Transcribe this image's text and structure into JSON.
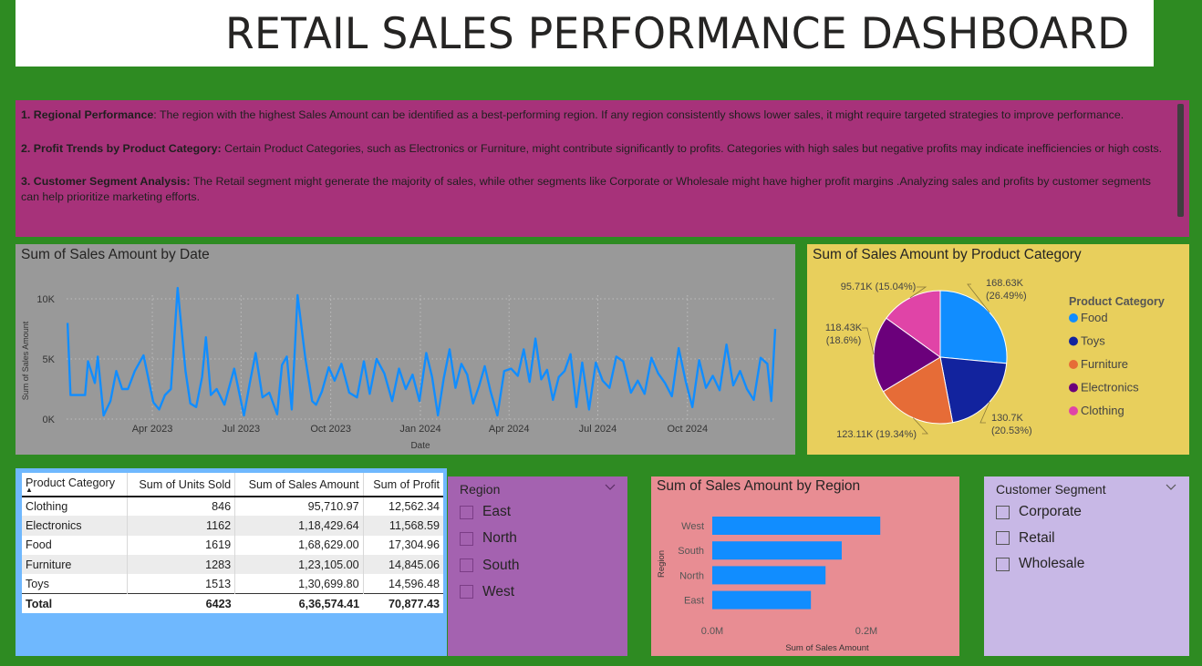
{
  "title": "RETAIL SALES PERFORMANCE DASHBOARD",
  "insights": [
    {
      "heading": "1. Regional Performance",
      "sep": ":   ",
      "text": "The region with the highest Sales Amount can be identified as a best-performing region. If any region consistently shows lower sales, it might require targeted strategies to improve performance."
    },
    {
      "heading": "2. Profit Trends by Product Category:",
      "sep": " ",
      "text": "Certain Product Categories, such as Electronics or Furniture, might contribute significantly to profits. Categories with high sales but negative profits may indicate inefficiencies or high costs."
    },
    {
      "heading": "3. Customer Segment Analysis:",
      "sep": " ",
      "text": "The Retail segment might generate the majority of sales, while other segments like Corporate or Wholesale might have higher profit margins .Analyzing sales and profits by customer segments can help prioritize marketing efforts."
    }
  ],
  "colors": {
    "background": "#2e8b22",
    "insights": "#a7327a",
    "line": "#118dff",
    "date_panel": "#999999",
    "category_panel": "#e8cf5c",
    "table_panel": "#6fb8fe",
    "region_slicer": "#a462b0",
    "region_bar_panel": "#e88d93",
    "segment_slicer": "#c8b8e6",
    "bar": "#118dff"
  },
  "table": {
    "headers": [
      "Product Category",
      "Sum of Units Sold",
      "Sum of Sales Amount",
      "Sum of Profit"
    ],
    "sort_icon": "sort-ascending-icon",
    "rows": [
      [
        "Clothing",
        "846",
        "95,710.97",
        "12,562.34"
      ],
      [
        "Electronics",
        "1162",
        "1,18,429.64",
        "11,568.59"
      ],
      [
        "Food",
        "1619",
        "1,68,629.00",
        "17,304.96"
      ],
      [
        "Furniture",
        "1283",
        "1,23,105.00",
        "14,845.06"
      ],
      [
        "Toys",
        "1513",
        "1,30,699.80",
        "14,596.48"
      ]
    ],
    "total": [
      "Total",
      "6423",
      "6,36,574.41",
      "70,877.43"
    ]
  },
  "region_slicer": {
    "title": "Region",
    "options": [
      "East",
      "North",
      "South",
      "West"
    ],
    "icon": "chevron-down-icon"
  },
  "segment_slicer": {
    "title": "Customer Segment",
    "options": [
      "Corporate",
      "Retail",
      "Wholesale"
    ],
    "icon": "chevron-down-icon"
  },
  "chart_data": [
    {
      "type": "line",
      "title": "Sum of Sales Amount by Date",
      "xlabel": "Date",
      "ylabel": "Sum of Sales Amount",
      "x_ticks": [
        "Apr 2023",
        "Jul 2023",
        "Oct 2023",
        "Jan 2024",
        "Apr 2024",
        "Jul 2024",
        "Oct 2024"
      ],
      "y_ticks": [
        "0K",
        "5K",
        "10K"
      ],
      "ylim": [
        0,
        10000
      ],
      "grid": true,
      "x_range": [
        "2023-01-03",
        "2024-12-30"
      ],
      "series": [
        {
          "x": [
            "2023-01-04",
            "2023-01-07",
            "2023-01-13",
            "2023-01-22",
            "2023-01-25",
            "2023-02-01",
            "2023-02-04",
            "2023-02-10",
            "2023-02-17",
            "2023-02-23",
            "2023-03-01",
            "2023-03-07",
            "2023-03-14",
            "2023-03-23",
            "2023-04-02",
            "2023-04-08",
            "2023-04-14",
            "2023-04-20",
            "2023-04-27",
            "2023-05-05",
            "2023-05-10",
            "2023-05-16",
            "2023-05-22",
            "2023-05-26",
            "2023-05-31",
            "2023-06-06",
            "2023-06-14",
            "2023-06-24",
            "2023-07-04",
            "2023-07-10",
            "2023-07-16",
            "2023-07-23",
            "2023-07-30",
            "2023-08-07",
            "2023-08-12",
            "2023-08-17",
            "2023-08-22",
            "2023-08-28",
            "2023-09-05",
            "2023-09-12",
            "2023-09-16",
            "2023-09-22",
            "2023-09-29",
            "2023-10-05",
            "2023-10-12",
            "2023-10-20",
            "2023-10-28",
            "2023-11-04",
            "2023-11-10",
            "2023-11-17",
            "2023-11-25",
            "2023-12-03",
            "2023-12-10",
            "2023-12-17",
            "2023-12-24",
            "2023-12-31",
            "2024-01-07",
            "2024-01-13",
            "2024-01-19",
            "2024-01-25",
            "2024-01-31",
            "2024-02-06",
            "2024-02-12",
            "2024-02-18",
            "2024-02-24",
            "2024-03-01",
            "2024-03-07",
            "2024-03-13",
            "2024-03-20",
            "2024-03-27",
            "2024-04-03",
            "2024-04-10",
            "2024-04-16",
            "2024-04-22",
            "2024-04-28",
            "2024-05-04",
            "2024-05-10",
            "2024-05-16",
            "2024-05-22",
            "2024-05-28",
            "2024-06-03",
            "2024-06-09",
            "2024-06-15",
            "2024-06-22",
            "2024-06-29",
            "2024-07-06",
            "2024-07-13",
            "2024-07-20",
            "2024-07-27",
            "2024-08-04",
            "2024-08-11",
            "2024-08-18",
            "2024-08-25",
            "2024-09-01",
            "2024-09-08",
            "2024-09-15",
            "2024-09-22",
            "2024-09-29",
            "2024-10-06",
            "2024-10-13",
            "2024-10-20",
            "2024-10-27",
            "2024-11-03",
            "2024-11-10",
            "2024-11-17",
            "2024-11-24",
            "2024-12-01",
            "2024-12-08",
            "2024-12-15",
            "2024-12-22",
            "2024-12-26",
            "2024-12-30"
          ],
          "values": [
            8000,
            2000,
            2000,
            2000,
            4800,
            3000,
            5200,
            300,
            1500,
            4000,
            2500,
            2500,
            4000,
            5300,
            1400,
            800,
            2000,
            2500,
            10900,
            4000,
            1300,
            1000,
            3500,
            6800,
            2000,
            2500,
            1200,
            4200,
            300,
            3000,
            5500,
            1800,
            2200,
            400,
            4500,
            5200,
            800,
            10300,
            5000,
            1500,
            1200,
            2300,
            4300,
            3200,
            4600,
            2200,
            1800,
            4800,
            2100,
            5000,
            3800,
            1500,
            4200,
            2500,
            3700,
            1500,
            5500,
            3500,
            300,
            3400,
            5800,
            2600,
            4600,
            3700,
            1300,
            2700,
            4400,
            2300,
            300,
            4000,
            4200,
            3600,
            5800,
            3100,
            6700,
            3300,
            4100,
            1600,
            3500,
            4000,
            5400,
            1000,
            4700,
            800,
            4700,
            3200,
            2600,
            5200,
            4800,
            2200,
            3200,
            2100,
            5100,
            3800,
            3000,
            1900,
            5900,
            3200,
            1000,
            4900,
            2600,
            3600,
            2400,
            6200,
            2800,
            4000,
            2500,
            1600,
            5100,
            4600,
            1500,
            7500
          ]
        }
      ]
    },
    {
      "type": "pie",
      "title": "Sum of Sales Amount by Product Category",
      "legend_title": "Product Category",
      "legend_position": "right",
      "categories": [
        "Food",
        "Toys",
        "Furniture",
        "Electronics",
        "Clothing"
      ],
      "values": [
        168630,
        130700,
        123110,
        118430,
        95710
      ],
      "labels": [
        "168.63K\n(26.49%)",
        "130.7K\n(20.53%)",
        "123.11K (19.34%)",
        "118.43K\n(18.6%)",
        "95.71K (15.04%)"
      ],
      "colors": [
        "#118dff",
        "#12239e",
        "#e66c37",
        "#6b007b",
        "#e044a7"
      ]
    },
    {
      "type": "bar",
      "title": "Sum of Sales Amount by Region",
      "xlabel": "Sum of Sales Amount",
      "ylabel": "Region",
      "categories": [
        "West",
        "South",
        "North",
        "East"
      ],
      "values": [
        218000,
        168000,
        147000,
        128000
      ],
      "x_ticks": [
        "0.0M",
        "0.2M"
      ],
      "xlim": [
        0,
        200000
      ]
    }
  ]
}
